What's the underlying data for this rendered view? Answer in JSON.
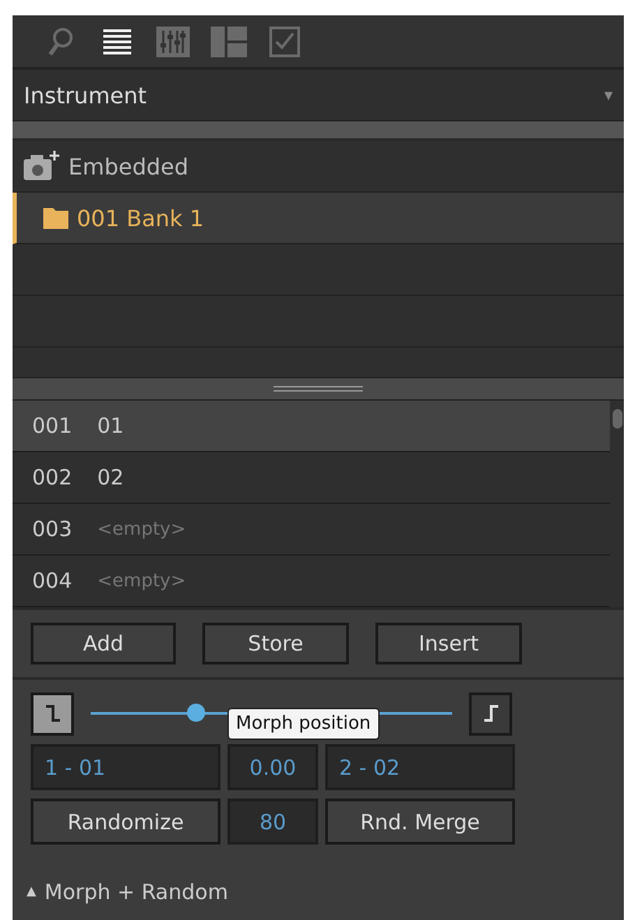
{
  "toolbar": [
    {
      "kind": "search",
      "selected": false
    },
    {
      "kind": "list",
      "selected": true
    },
    {
      "kind": "mixer",
      "selected": false
    },
    {
      "kind": "layout",
      "selected": false
    },
    {
      "kind": "check",
      "selected": false
    }
  ],
  "dropdown": {
    "value": "Instrument",
    "arrow": "▾"
  },
  "tree": [
    {
      "label": "Embedded",
      "kind": "root",
      "selected": false,
      "children": [
        {
          "label": "001 Bank 1",
          "kind": "folder",
          "selected": true
        }
      ]
    }
  ],
  "programs": [
    {
      "number": "001",
      "name": "01",
      "empty": false,
      "selected": true
    },
    {
      "number": "002",
      "name": "02",
      "empty": false,
      "selected": false
    },
    {
      "number": "003",
      "name": "<empty>",
      "empty": true,
      "selected": false
    },
    {
      "number": "004",
      "name": "<empty>",
      "empty": true,
      "selected": false
    }
  ],
  "buttons": [
    "Add",
    "Store",
    "Insert"
  ],
  "morph": {
    "left_toggle_on": true,
    "right_toggle_on": false,
    "level": 0.29,
    "tooltip": "Morph position",
    "left": "1 - 01",
    "value": "0.00",
    "right": "2 - 02"
  },
  "random": {
    "randomize": "Randomize",
    "amount": "80",
    "merge": "Rnd. Merge"
  },
  "footer": {
    "arrow": "▲",
    "label": "Morph + Random"
  }
}
